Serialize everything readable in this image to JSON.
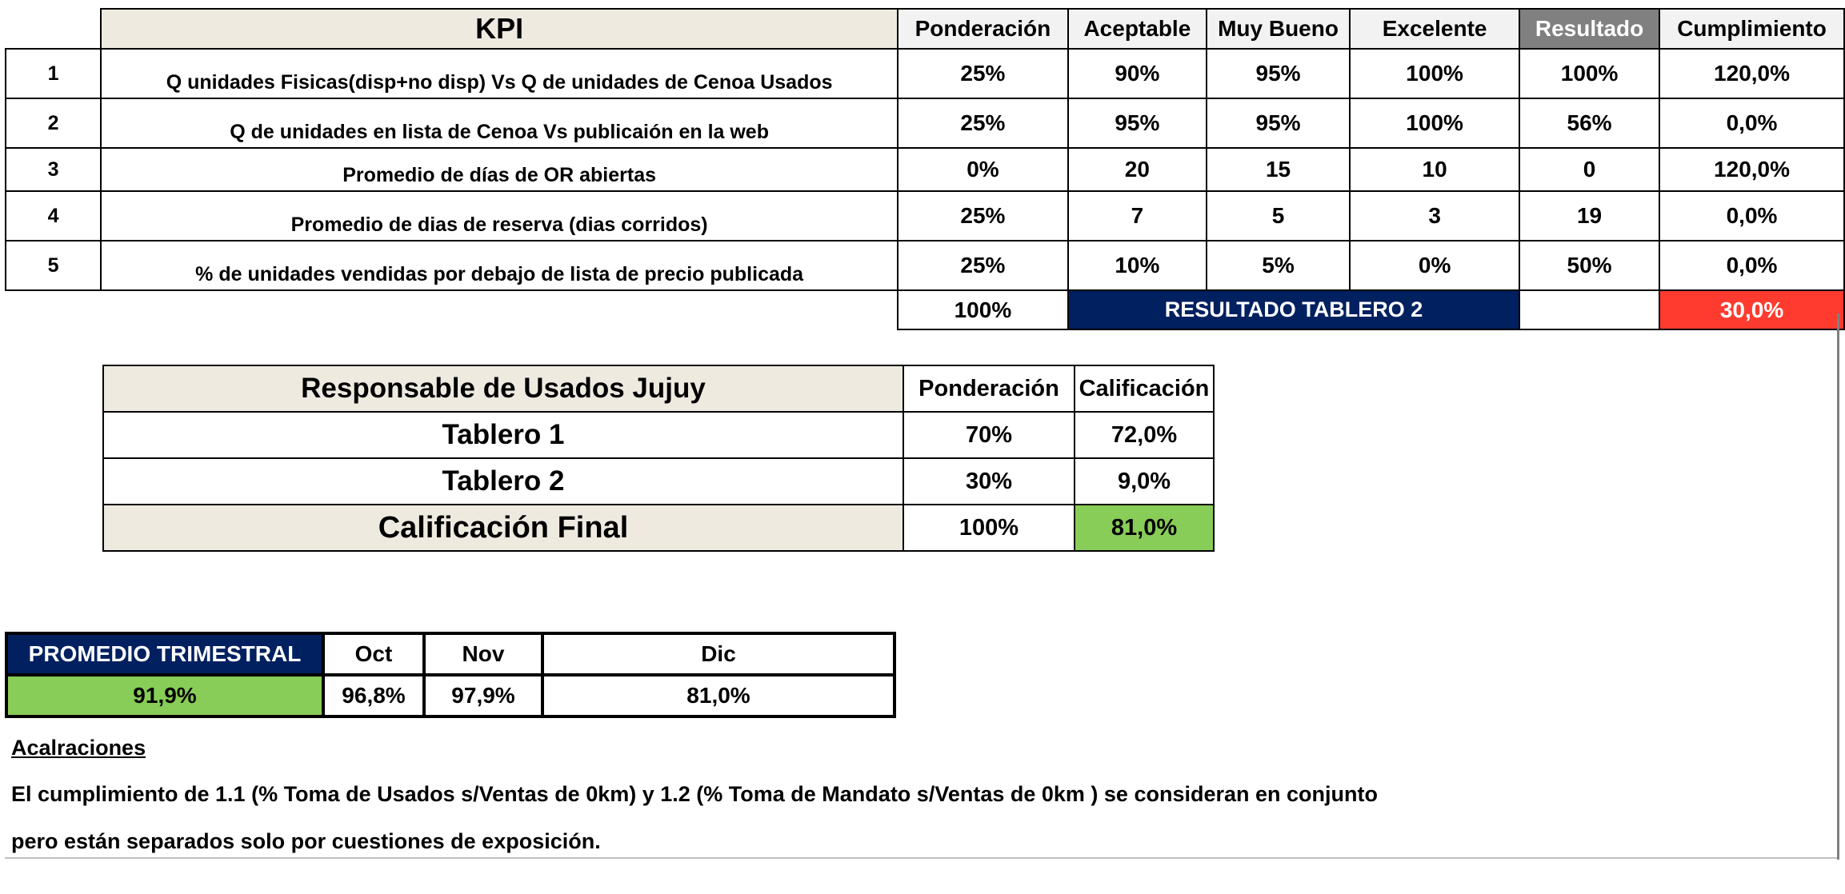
{
  "kpi_table": {
    "headers": {
      "kpi": "KPI",
      "ponderacion": "Ponderación",
      "aceptable": "Aceptable",
      "muy_bueno": "Muy Bueno",
      "excelente": "Excelente",
      "resultado": "Resultado",
      "cumplimiento": "Cumplimiento"
    },
    "rows": [
      {
        "num": "1",
        "kpi": "Q unidades Fisicas(disp+no disp) Vs Q de unidades de Cenoa Usados",
        "ponderacion": "25%",
        "aceptable": "90%",
        "muy_bueno": "95%",
        "excelente": "100%",
        "resultado": "100%",
        "cumplimiento": "120,0%"
      },
      {
        "num": "2",
        "kpi": "Q de unidades en lista de Cenoa Vs publicaión en la web",
        "ponderacion": "25%",
        "aceptable": "95%",
        "muy_bueno": "95%",
        "excelente": "100%",
        "resultado": "56%",
        "cumplimiento": "0,0%"
      },
      {
        "num": "3",
        "kpi": "Promedio de días de OR abiertas",
        "ponderacion": "0%",
        "aceptable": "20",
        "muy_bueno": "15",
        "excelente": "10",
        "resultado": "0",
        "cumplimiento": "120,0%"
      },
      {
        "num": "4",
        "kpi": "Promedio de dias de reserva (dias corridos)",
        "ponderacion": "25%",
        "aceptable": "7",
        "muy_bueno": "5",
        "excelente": "3",
        "resultado": "19",
        "cumplimiento": "0,0%"
      },
      {
        "num": "5",
        "kpi": "% de unidades vendidas por debajo de lista de precio publicada",
        "ponderacion": "25%",
        "aceptable": "10%",
        "muy_bueno": "5%",
        "excelente": "0%",
        "resultado": "50%",
        "cumplimiento": "0,0%"
      }
    ],
    "total": {
      "ponderacion": "100%",
      "label": "RESULTADO TABLERO 2",
      "resultado": "",
      "cumplimiento": "30,0%"
    }
  },
  "responsable_table": {
    "title": "Responsable de Usados Jujuy",
    "ponderacion_header": "Ponderación",
    "calificacion_header": "Calificación",
    "rows": [
      {
        "label": "Tablero 1",
        "ponderacion": "70%",
        "calificacion": "72,0%"
      },
      {
        "label": "Tablero 2",
        "ponderacion": "30%",
        "calificacion": "9,0%"
      }
    ],
    "final": {
      "label": "Calificación Final",
      "ponderacion": "100%",
      "calificacion": "81,0%"
    }
  },
  "trimestral_table": {
    "label": "PROMEDIO TRIMESTRAL",
    "value": "91,9%",
    "months": [
      {
        "name": "Oct",
        "value": "96,8%"
      },
      {
        "name": "Nov",
        "value": "97,9%"
      },
      {
        "name": "Dic",
        "value": "81,0%"
      }
    ]
  },
  "notes": {
    "title": "Acalraciones",
    "line1": "El cumplimiento de 1.1 (% Toma de Usados s/Ventas de 0km) y 1.2 (% Toma de Mandato s/Ventas de 0km ) se consideran en conjunto",
    "line2": "pero están separados  solo por cuestiones de exposición."
  },
  "colors": {
    "navy_header": "#002060",
    "resultado_header": "#808080",
    "red_result": "#ff3b2f",
    "green_result": "#88cd57",
    "beige_header": "#eeeae0"
  }
}
